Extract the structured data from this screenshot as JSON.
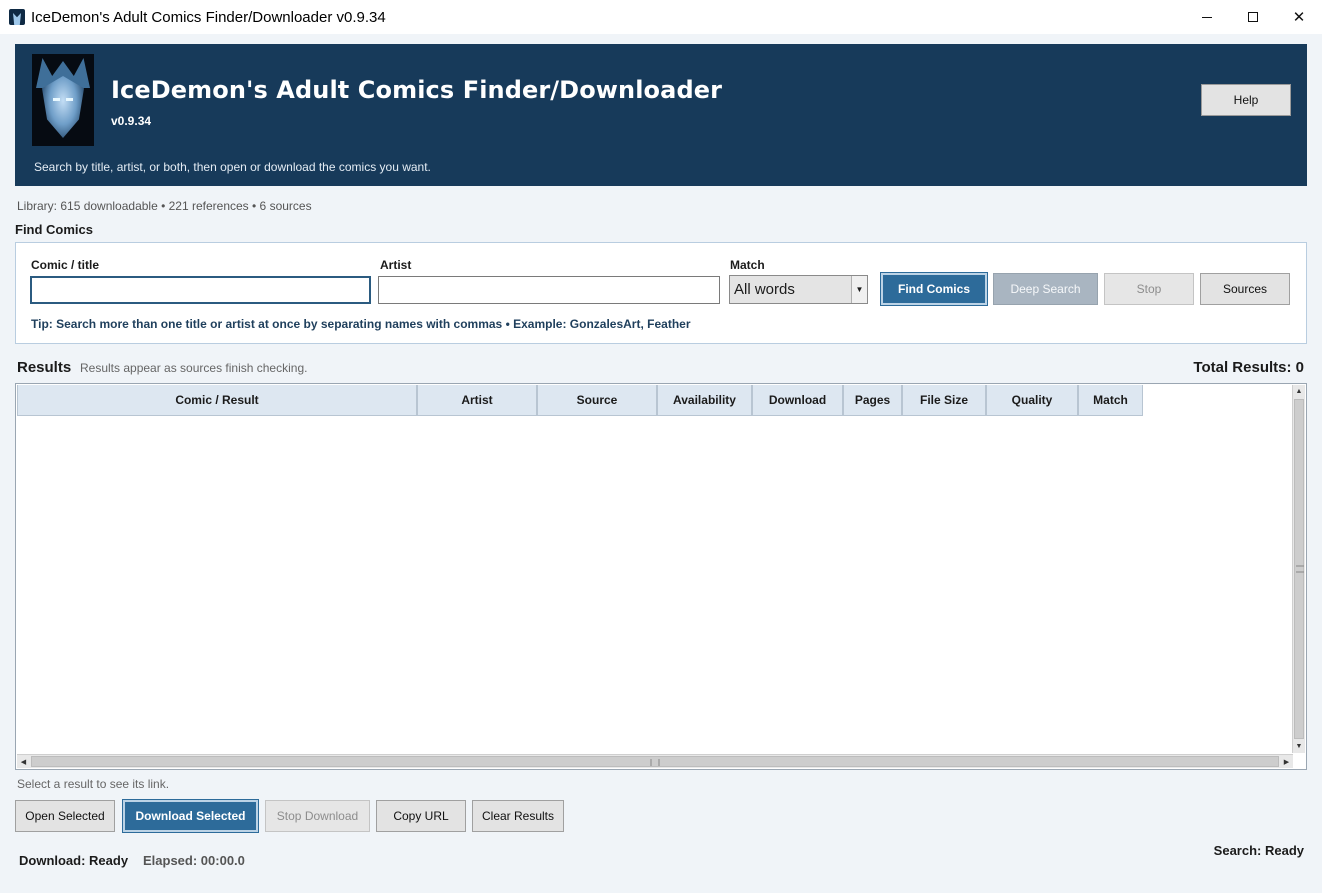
{
  "window": {
    "title": "IceDemon's Adult Comics Finder/Downloader v0.9.34",
    "minimize": "",
    "maximize": "",
    "close": "✕"
  },
  "banner": {
    "title": "IceDemon's Adult Comics Finder/Downloader",
    "version": "v0.9.34",
    "subtitle": "Search by title, artist, or both, then open or download the comics you want.",
    "help_label": "Help"
  },
  "library": "Library: 615 downloadable • 221 references • 6 sources",
  "find": {
    "section_label": "Find Comics",
    "title_label": "Comic / title",
    "title_value": "",
    "artist_label": "Artist",
    "artist_value": "",
    "match_label": "Match",
    "match_value": "All words",
    "buttons": {
      "find": "Find Comics",
      "deep": "Deep Search",
      "stop": "Stop",
      "sources": "Sources"
    },
    "tip": "Tip: Search more than one title or artist at once by separating names with commas  •  Example: GonzalesArt, Feather"
  },
  "results": {
    "label": "Results",
    "hint": "Results appear as sources finish checking.",
    "total": "Total Results: 0",
    "columns": [
      "Comic / Result",
      "Artist",
      "Source",
      "Availability",
      "Download",
      "Pages",
      "File Size",
      "Quality",
      "Match"
    ]
  },
  "select_hint": "Select a result to see its link.",
  "actions": {
    "open": "Open Selected",
    "download": "Download Selected",
    "stop_download": "Stop Download",
    "copy": "Copy URL",
    "clear": "Clear Results"
  },
  "status": {
    "download": "Download: Ready",
    "elapsed": "Elapsed: 00:00.0",
    "search": "Search: Ready"
  },
  "colors": {
    "banner": "#173a5a",
    "primary_button": "#2d6b9a",
    "background": "#f0f4f8"
  },
  "icons": {
    "app": "demon-mask-icon",
    "minimize": "minimize-icon",
    "maximize": "maximize-icon",
    "close": "close-icon",
    "dropdown": "chevron-down-icon"
  }
}
